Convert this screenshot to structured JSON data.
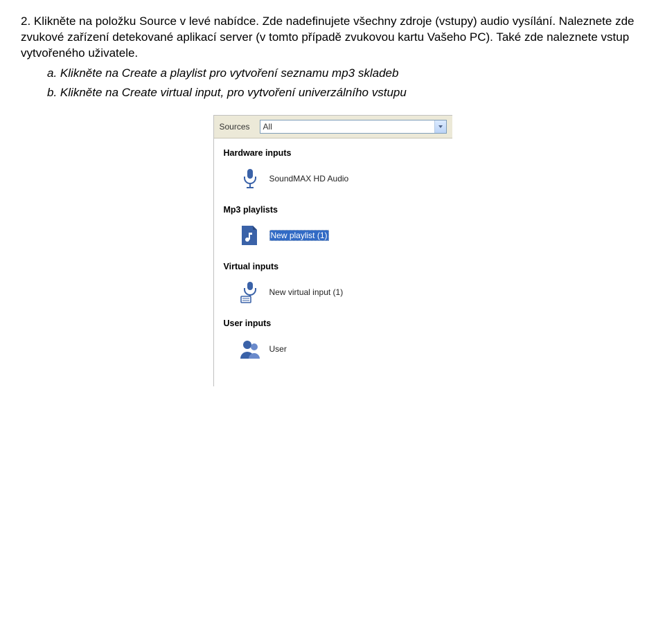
{
  "intro": {
    "num": "2.",
    "text": "Klikněte na položku Source v levé nabídce. Zde nadefinujete všechny zdroje (vstupy) audio vysílání. Naleznete zde zvukové zařízení detekované aplikací server (v tomto případě zvukovou kartu Vašeho PC). Také zde naleznete vstup vytvořeného uživatele."
  },
  "sub": {
    "a": {
      "letter": "a.",
      "text": "Klikněte na Create a playlist pro vytvoření seznamu mp3 skladeb"
    },
    "b": {
      "letter": "b.",
      "text": "Klikněte na Create virtual input, pro vytvoření univerzálního vstupu"
    }
  },
  "panel": {
    "filter_label": "Sources",
    "filter_value": "All",
    "sections": {
      "hardware": {
        "title": "Hardware inputs",
        "item": "SoundMAX HD Audio"
      },
      "mp3": {
        "title": "Mp3 playlists",
        "item": "New playlist (1)"
      },
      "virtual": {
        "title": "Virtual inputs",
        "item": "New virtual input (1)"
      },
      "user": {
        "title": "User inputs",
        "item": "User"
      }
    }
  }
}
